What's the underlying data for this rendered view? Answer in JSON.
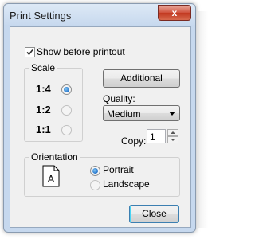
{
  "window": {
    "title": "Print Settings",
    "close_glyph": "x"
  },
  "show_before_printout": {
    "label": "Show before printout",
    "checked": true
  },
  "scale": {
    "title": "Scale",
    "options": [
      {
        "label": "1:4",
        "selected": true
      },
      {
        "label": "1:2",
        "selected": false
      },
      {
        "label": "1:1",
        "selected": false
      }
    ]
  },
  "additional_button": "Additional",
  "quality": {
    "label": "Quality:",
    "value": "Medium"
  },
  "copy": {
    "label": "Copy:",
    "value": "1"
  },
  "orientation": {
    "title": "Orientation",
    "page_letter": "A",
    "options": [
      {
        "label": "Portrait",
        "selected": true
      },
      {
        "label": "Landscape",
        "selected": false
      }
    ]
  },
  "close_button": "Close",
  "icons": [
    "close-icon",
    "checkmark-icon",
    "dropdown-arrow-icon",
    "spin-up-icon",
    "spin-down-icon",
    "page-portrait-icon"
  ],
  "colors": {
    "radio_on": "#2673c9",
    "close_red": "#c1381f",
    "title_glass": "#c6d8ee",
    "dialog_bg": "#f0f0f0"
  }
}
